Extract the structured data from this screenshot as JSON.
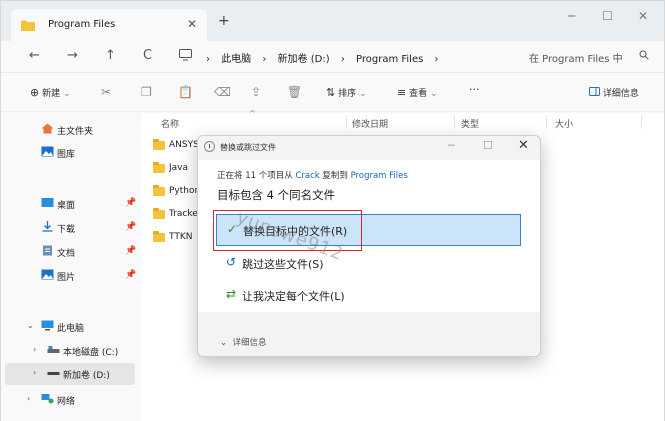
{
  "tab": {
    "title": "Program Files",
    "close": "✕",
    "new": "+"
  },
  "window_controls": {
    "minimize": "─",
    "maximize": "☐",
    "close": "✕"
  },
  "nav": {
    "back": "←",
    "forward": "→",
    "up": "↑",
    "refresh": "C"
  },
  "breadcrumb": [
    "此电脑",
    "新加卷 (D:)",
    "Program Files"
  ],
  "breadcrumb_sep": "›",
  "search": {
    "placeholder": "在 Program Files 中",
    "icon": "search-icon"
  },
  "commands": {
    "new": "新建",
    "sort": "排序",
    "view": "查看",
    "more": "···",
    "details": "详细信息"
  },
  "sidebar": {
    "home": "主文件夹",
    "gallery": "图库",
    "desktop": "桌面",
    "downloads": "下载",
    "documents": "文档",
    "pictures": "图片",
    "this_pc": "此电脑",
    "local_disk": "本地磁盘 (C:)",
    "new_volume": "新加卷 (D:)",
    "network": "网络"
  },
  "columns": {
    "name": "名称",
    "modified": "修改日期",
    "type": "类型",
    "size": "大小"
  },
  "files": [
    "ANSYS",
    "Java",
    "Python",
    "Tracker",
    "TTKN"
  ],
  "dialog": {
    "title": "替换或跳过文件",
    "progress_prefix": "正在将 11 个项目从 ",
    "source": "Crack",
    "progress_middle": " 复制到 ",
    "destination": "Program Files",
    "heading": "目标包含 4 个同名文件",
    "replace": "替换目标中的文件(R)",
    "skip": "跳过这些文件(S)",
    "decide": "让我决定每个文件(L)",
    "details": "详细信息",
    "min": "─",
    "max": "☐",
    "close": "✕"
  },
  "watermark": "yunswe912",
  "colors": {
    "accent": "#3c7fc2",
    "highlight": "#cce4f7",
    "annotation": "#d9262e",
    "folder": "#f3c33b"
  }
}
